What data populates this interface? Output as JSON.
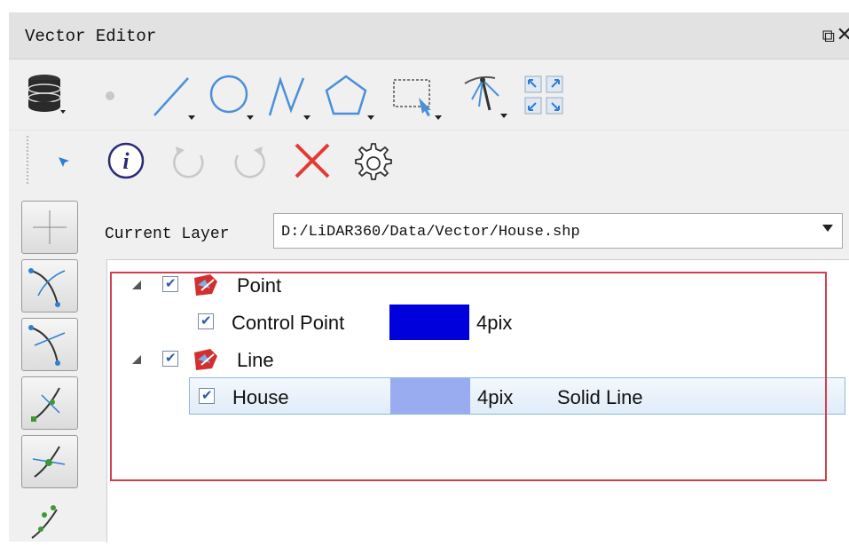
{
  "window": {
    "title": "Vector Editor",
    "float_icon": "float-window-icon",
    "close_icon": "close-icon"
  },
  "toolbar_primary": {
    "icons": [
      "database-layers-icon",
      "point-tool-icon",
      "line-tool-icon",
      "circle-tool-icon",
      "polyline-tool-icon",
      "polygon-tool-icon",
      "rectangle-select-icon",
      "lasso-select-icon",
      "fit-extent-icon"
    ]
  },
  "toolbar_secondary": {
    "icons": [
      "select-pointer-icon",
      "info-icon",
      "undo-icon",
      "redo-icon",
      "delete-icon",
      "settings-gear-icon"
    ],
    "colors": {
      "delete": "#e53935",
      "info": "#2a2a7a"
    }
  },
  "sidebar": {
    "icons": [
      "crosshair-tool-icon",
      "curve-edit-icon",
      "curve-node-icon",
      "split-line-icon",
      "merge-node-icon",
      "node-extra-icon"
    ]
  },
  "current_layer": {
    "label": "Current Layer",
    "value": "D:/LiDAR360/Data/Vector/House.shp"
  },
  "tree": {
    "groups": [
      {
        "name": "Point",
        "checked": true,
        "layers": [
          {
            "name": "Control Point",
            "checked": true,
            "color": "#0000dd",
            "size": "4pix",
            "style": ""
          }
        ]
      },
      {
        "name": "Line",
        "checked": true,
        "layers": [
          {
            "name": "House",
            "checked": true,
            "color": "#9aacf0",
            "size": "4pix",
            "style": "Solid Line",
            "selected": true
          }
        ]
      }
    ]
  },
  "colors": {
    "accent": "#2e7fd0",
    "highlight_box": "#d04050"
  }
}
